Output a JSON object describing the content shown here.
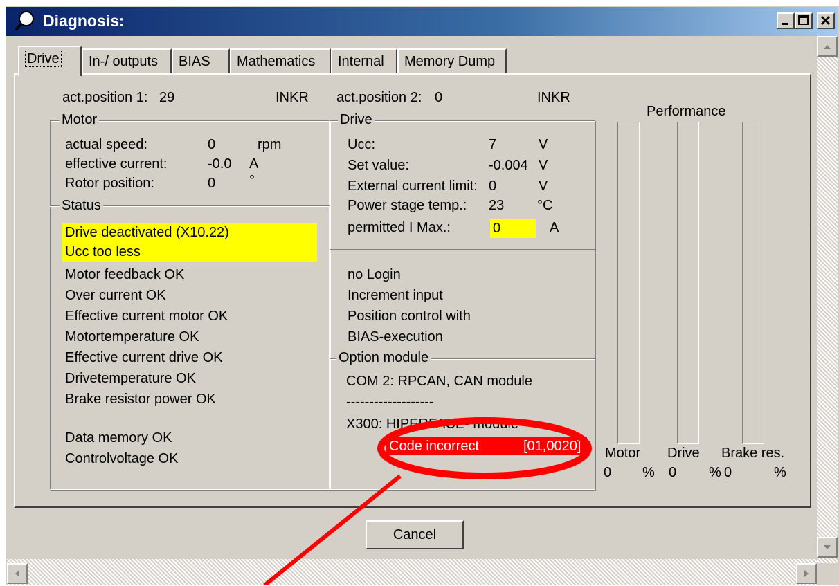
{
  "window": {
    "title": "Diagnosis:"
  },
  "tabs": [
    {
      "label": "Drive",
      "active": true
    },
    {
      "label": "In-/ outputs"
    },
    {
      "label": "BIAS"
    },
    {
      "label": "Mathematics"
    },
    {
      "label": "Internal"
    },
    {
      "label": "Memory Dump"
    }
  ],
  "positions": {
    "pos1_label": "act.position 1:",
    "pos1_value": "29",
    "pos1_unit": "INKR",
    "pos2_label": "act.position 2:",
    "pos2_value": "0",
    "pos2_unit": "INKR"
  },
  "motor": {
    "title": "Motor",
    "rows": [
      {
        "label": "actual speed:",
        "value": "0",
        "unit": "rpm"
      },
      {
        "label": "effective current:",
        "value": "-0.0",
        "unit": "A"
      },
      {
        "label": "Rotor position:",
        "value": "0",
        "unit": "°"
      }
    ]
  },
  "status": {
    "title": "Status",
    "highlighted": [
      "Drive deactivated (X10.22)",
      "Ucc too less"
    ],
    "items": [
      "Motor feedback OK",
      "Over current OK",
      "Effective current motor OK",
      "Motortemperature OK",
      "Effective current drive OK",
      "Drivetemperature OK",
      "Brake resistor power OK"
    ],
    "items2": [
      "Data memory OK",
      "Controlvoltage OK"
    ]
  },
  "drive": {
    "title": "Drive",
    "rows": [
      {
        "label": "Ucc:",
        "value": "7",
        "unit": "V"
      },
      {
        "label": "Set value:",
        "value": "-0.004",
        "unit": "V"
      },
      {
        "label": "External current limit:",
        "value": "0",
        "unit": "V"
      },
      {
        "label": "Power stage temp.:",
        "value": "23",
        "unit": "°C"
      },
      {
        "label": "permitted I Max.:",
        "value": "0",
        "unit": "A"
      }
    ]
  },
  "info": {
    "lines": [
      "no Login",
      "Increment input",
      "Position control with",
      "BIAS-execution"
    ]
  },
  "option_module": {
    "title": "Option module",
    "line1": "COM 2: RPCAN, CAN module",
    "separator": "-------------------",
    "line2": "X300: HIPERFACE- module",
    "error_label": "Code incorrect",
    "error_code": "[01,0020]"
  },
  "performance": {
    "title": "Performance",
    "bars": [
      {
        "label": "Motor",
        "value": "0",
        "unit": "%",
        "fill": 0
      },
      {
        "label": "Drive",
        "value": "0",
        "unit": "%",
        "fill": 0
      },
      {
        "label": "Brake res.",
        "value": "0",
        "unit": "%",
        "fill": 0
      }
    ]
  },
  "buttons": {
    "cancel": "Cancel"
  },
  "colors": {
    "highlight": "#ffff00",
    "error": "#ff0000",
    "annotation": "#ff0000",
    "titlebar": "#0a246a"
  }
}
